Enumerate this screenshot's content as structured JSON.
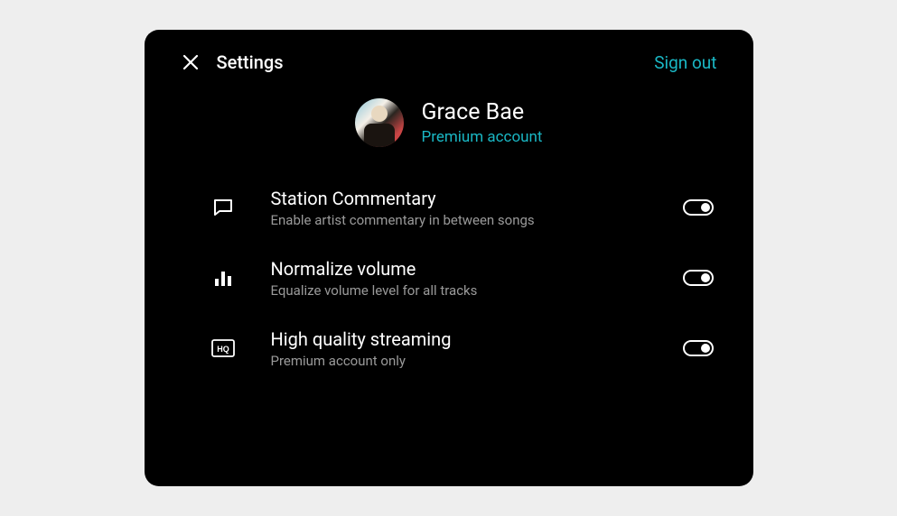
{
  "header": {
    "title": "Settings",
    "signOutLabel": "Sign out"
  },
  "profile": {
    "name": "Grace Bae",
    "accountType": "Premium account"
  },
  "settings": [
    {
      "icon": "comment",
      "title": "Station Commentary",
      "subtitle": "Enable artist commentary in between songs",
      "enabled": true
    },
    {
      "icon": "equalizer",
      "title": "Normalize volume",
      "subtitle": "Equalize volume level for all tracks",
      "enabled": true
    },
    {
      "icon": "hq",
      "title": "High quality streaming",
      "subtitle": "Premium account only",
      "enabled": true
    }
  ]
}
